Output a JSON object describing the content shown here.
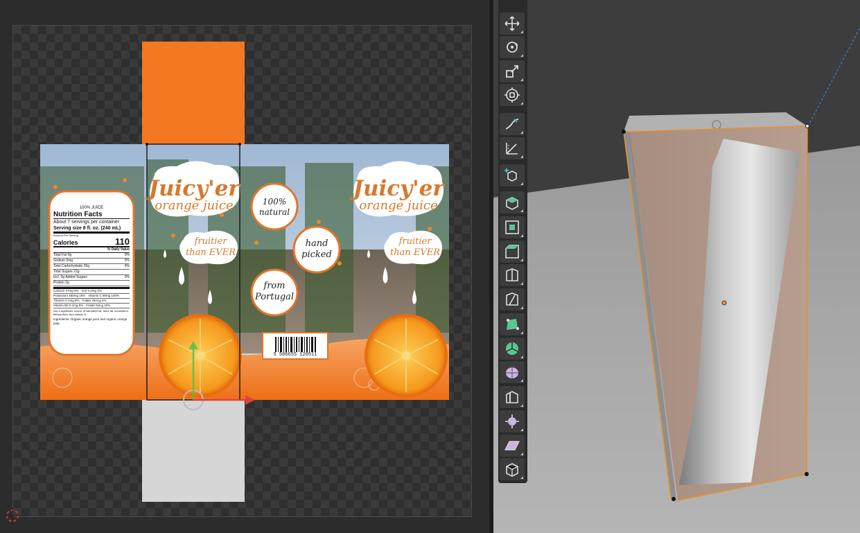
{
  "uv_editor": {
    "brand": "Juicy'er",
    "product": "orange juice",
    "tagline": "fruitier than EVER",
    "badges": {
      "natural": "100% natural",
      "picked": "hand picked",
      "origin": "from Portugal"
    },
    "barcode_number": "5 506655 120511",
    "nutrition": {
      "top": "100% JUICE",
      "title": "Nutrition Facts",
      "servings": "About 7 servings per container",
      "serving_size": "Serving size 8 fl. oz. (240 mL)",
      "amount_per": "Amount Per Serving",
      "calories_label": "Calories",
      "calories_value": "110",
      "dv_header": "% Daily Value",
      "rows": [
        {
          "label": "Total Fat 0g",
          "dv": "0%"
        },
        {
          "label": "Sodium 0mg",
          "dv": "0%"
        },
        {
          "label": "Total Carbohydrate 26g",
          "dv": "9%"
        },
        {
          "label": "Total Sugars 22g",
          "dv": ""
        },
        {
          "label": "Incl. 0g Added Sugars",
          "dv": "0%"
        },
        {
          "label": "Protein 2g",
          "dv": ""
        }
      ],
      "minerals": [
        "Calcium 27mg 2% · Iron 0.2mg 2%",
        "Potassium 450mg 10% · Vitamin C 90mg 100%",
        "Thiamin 0.1mg 8% · Folate 75mcg 4%",
        "Vitamin B6 0.1mg 6% · Folate 0mcg 10%"
      ],
      "footnote": "Not a significant source of saturated fat, trans fat, cholesterol, dietary fiber, and vitamin D.",
      "ingredients": "Ingredients: Organic orange juice and organic orange pulp."
    }
  },
  "toolbar": {
    "tools": [
      {
        "name": "move-tool",
        "icon": "move-icon"
      },
      {
        "name": "rotate-tool",
        "icon": "rotate-icon"
      },
      {
        "name": "scale-tool",
        "icon": "scale-icon"
      },
      {
        "name": "transform-tool",
        "icon": "transform-icon"
      },
      {
        "name": "annotate-tool",
        "icon": "annotate-icon"
      },
      {
        "name": "measure-tool",
        "icon": "measure-icon"
      },
      {
        "name": "add-cube-tool",
        "icon": "add-cube-icon"
      },
      {
        "name": "extrude-region-tool",
        "icon": "extrude-icon"
      },
      {
        "name": "inset-faces-tool",
        "icon": "inset-icon"
      },
      {
        "name": "bevel-tool",
        "icon": "bevel-icon"
      },
      {
        "name": "loop-cut-tool",
        "icon": "loop-cut-icon"
      },
      {
        "name": "knife-tool",
        "icon": "knife-icon"
      },
      {
        "name": "poly-build-tool",
        "icon": "poly-build-icon"
      },
      {
        "name": "spin-tool",
        "icon": "spin-icon"
      },
      {
        "name": "smooth-tool",
        "icon": "smooth-icon"
      },
      {
        "name": "edge-slide-tool",
        "icon": "edge-slide-icon"
      },
      {
        "name": "shrink-fatten-tool",
        "icon": "shrink-fatten-icon"
      },
      {
        "name": "shear-tool",
        "icon": "shear-icon"
      },
      {
        "name": "rip-region-tool",
        "icon": "rip-icon"
      }
    ]
  },
  "colors": {
    "orange": "#f47722",
    "orange_text": "#d9782b",
    "toolbar_bg": "#2a2a2a",
    "tool_bg": "#3c3c3c",
    "selected_edge": "#e8902c",
    "mesh_face": "#b09686"
  }
}
